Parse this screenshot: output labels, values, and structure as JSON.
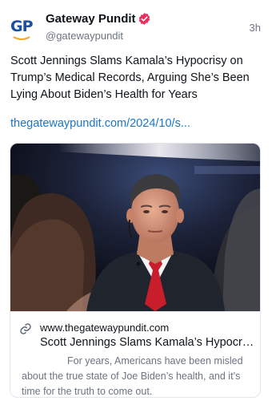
{
  "post": {
    "author": {
      "name": "Gateway Pundit",
      "handle": "@gatewaypundit",
      "avatar_text": "GP",
      "verified_color": "#e8305f"
    },
    "timestamp": "3h",
    "text": "Scott Jennings Slams Kamala’s Hypocrisy on Trump’s Medical Records, Arguing She’s Been Lying About Biden’s Health for Years",
    "link": "thegatewaypundit.com/2024/10/s...",
    "card": {
      "image_icon": "news-photo-man-red-tie",
      "domain": "www.thegatewaypundit.com",
      "title": "Scott Jennings Slams Kamala’s Hypocrisy on Trump’s Medical Records",
      "description": "For years, Americans have been misled about the true state of Joe Biden’s health, and it’s time for the truth to come out."
    }
  },
  "colors": {
    "link": "#1b76c9",
    "secondary_text": "#6b7480",
    "brand_blue": "#1b4fa0",
    "brand_orange": "#f5a623"
  }
}
